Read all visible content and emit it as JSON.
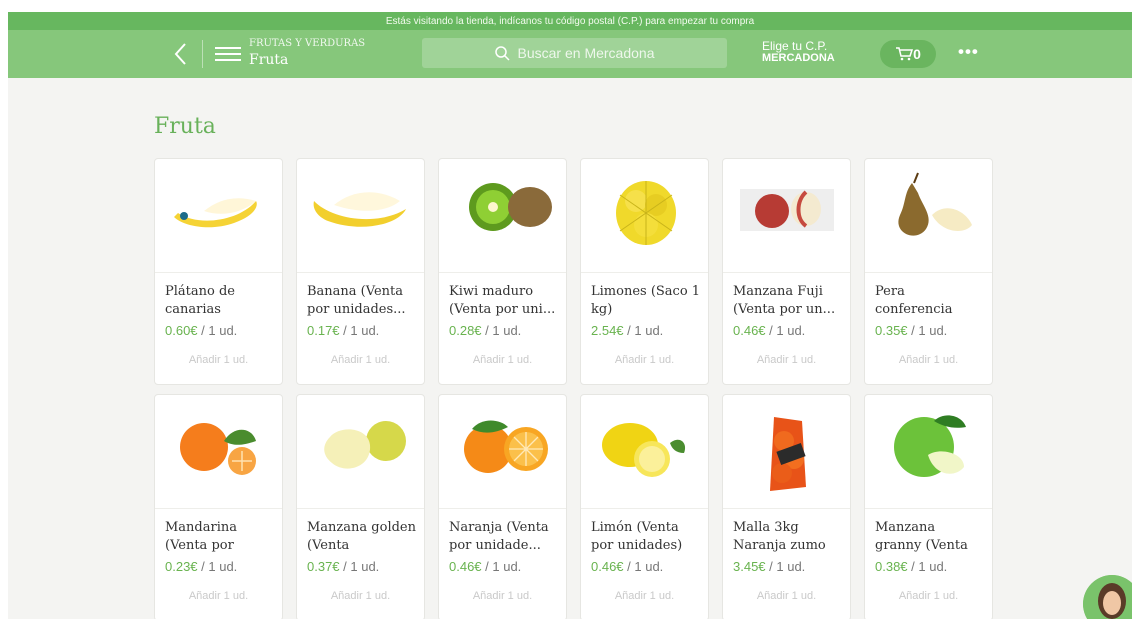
{
  "notice": "Estás visitando la tienda, indícanos tu código postal (C.P.) para empezar tu compra",
  "header": {
    "category": "FRUTAS Y VERDURAS",
    "subcategory": "Fruta",
    "search_placeholder": "Buscar en Mercadona",
    "cp_label": "Elige tu C.P.",
    "cp_store": "MERCADONA",
    "cart_count": "0",
    "more": "•••"
  },
  "page_title": "Fruta",
  "products": [
    {
      "name": "Plátano de canarias",
      "price": "0.60€",
      "unit": " / 1 ud.",
      "add": "Añadir 1 ud.",
      "icon": "plantain-banana-icon"
    },
    {
      "name": "Banana (Venta por unidades...",
      "price": "0.17€",
      "unit": " / 1 ud.",
      "add": "Añadir 1 ud.",
      "icon": "banana-icon"
    },
    {
      "name": "Kiwi maduro (Venta por uni...",
      "price": "0.28€",
      "unit": " / 1 ud.",
      "add": "Añadir 1 ud.",
      "icon": "kiwi-icon"
    },
    {
      "name": "Limones (Saco 1 kg)",
      "price": "2.54€",
      "unit": " / 1 ud.",
      "add": "Añadir 1 ud.",
      "icon": "lemon-bag-icon"
    },
    {
      "name": "Manzana Fuji (Venta por un...",
      "price": "0.46€",
      "unit": " / 1 ud.",
      "add": "Añadir 1 ud.",
      "icon": "fuji-apple-icon"
    },
    {
      "name": "Pera conferencia",
      "price": "0.35€",
      "unit": " / 1 ud.",
      "add": "Añadir 1 ud.",
      "icon": "pear-icon"
    },
    {
      "name": "Mandarina (Venta por",
      "price": "0.23€",
      "unit": " / 1 ud.",
      "add": "Añadir 1 ud.",
      "icon": "mandarin-icon"
    },
    {
      "name": "Manzana golden (Venta",
      "price": "0.37€",
      "unit": " / 1 ud.",
      "add": "Añadir 1 ud.",
      "icon": "golden-apple-icon"
    },
    {
      "name": "Naranja (Venta por unidade...",
      "price": "0.46€",
      "unit": " / 1 ud.",
      "add": "Añadir 1 ud.",
      "icon": "orange-icon"
    },
    {
      "name": "Limón (Venta por unidades)",
      "price": "0.46€",
      "unit": " / 1 ud.",
      "add": "Añadir 1 ud.",
      "icon": "lemon-icon"
    },
    {
      "name": "Malla 3kg Naranja zumo",
      "price": "3.45€",
      "unit": " / 1 ud.",
      "add": "Añadir 1 ud.",
      "icon": "orange-mesh-bag-icon"
    },
    {
      "name": "Manzana granny (Venta",
      "price": "0.38€",
      "unit": " / 1 ud.",
      "add": "Añadir 1 ud.",
      "icon": "granny-apple-icon"
    }
  ],
  "colors": {
    "brand_green": "#86c77b",
    "price_green": "#69b34f",
    "title_green": "#68b15a"
  }
}
